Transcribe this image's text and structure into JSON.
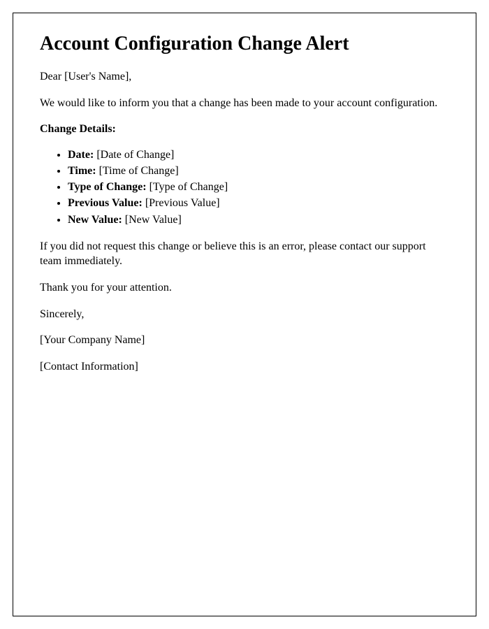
{
  "title": "Account Configuration Change Alert",
  "greeting": "Dear [User's Name],",
  "intro": "We would like to inform you that a change has been made to your account configuration.",
  "details_heading": "Change Details:",
  "details": [
    {
      "label": "Date:",
      "value": "[Date of Change]"
    },
    {
      "label": "Time:",
      "value": "[Time of Change]"
    },
    {
      "label": "Type of Change:",
      "value": "[Type of Change]"
    },
    {
      "label": "Previous Value:",
      "value": "[Previous Value]"
    },
    {
      "label": "New Value:",
      "value": "[New Value]"
    }
  ],
  "warning": "If you did not request this change or believe this is an error, please contact our support team immediately.",
  "thanks": "Thank you for your attention.",
  "signoff": "Sincerely,",
  "company": "[Your Company Name]",
  "contact": "[Contact Information]"
}
